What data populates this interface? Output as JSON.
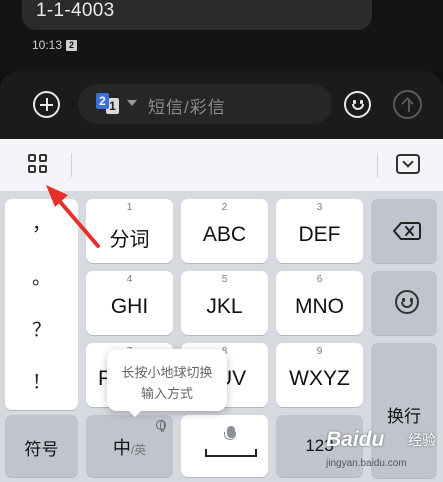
{
  "message": {
    "text": "1-1-4003",
    "time": "10:13",
    "sim_badge": "2"
  },
  "compose": {
    "sim_top": "2",
    "sim_bottom": "1",
    "placeholder": "短信/彩信"
  },
  "keyboard": {
    "punctuation": [
      "，",
      "。",
      "？",
      "！"
    ],
    "rows": [
      [
        {
          "num": "1",
          "label": "分词"
        },
        {
          "num": "2",
          "label": "ABC"
        },
        {
          "num": "3",
          "label": "DEF"
        }
      ],
      [
        {
          "num": "4",
          "label": "GHI"
        },
        {
          "num": "5",
          "label": "JKL"
        },
        {
          "num": "6",
          "label": "MNO"
        }
      ],
      [
        {
          "num": "7",
          "label": "P"
        },
        {
          "num": "8",
          "label": "UV"
        },
        {
          "num": "9",
          "label": "WXYZ"
        }
      ]
    ],
    "enter_label": "换行",
    "symbol_label": "符号",
    "lang_main": "中",
    "lang_alt": "/英",
    "num_label": "123"
  },
  "tooltip": {
    "line1": "长按小地球切换",
    "line2": "输入方式"
  },
  "watermark": {
    "brand": "Baidu",
    "jingyan": "经验",
    "url": "jingyan.baidu.com"
  },
  "colors": {
    "annotation_arrow": "#e8302a",
    "sim_accent": "#3b6fe0"
  }
}
